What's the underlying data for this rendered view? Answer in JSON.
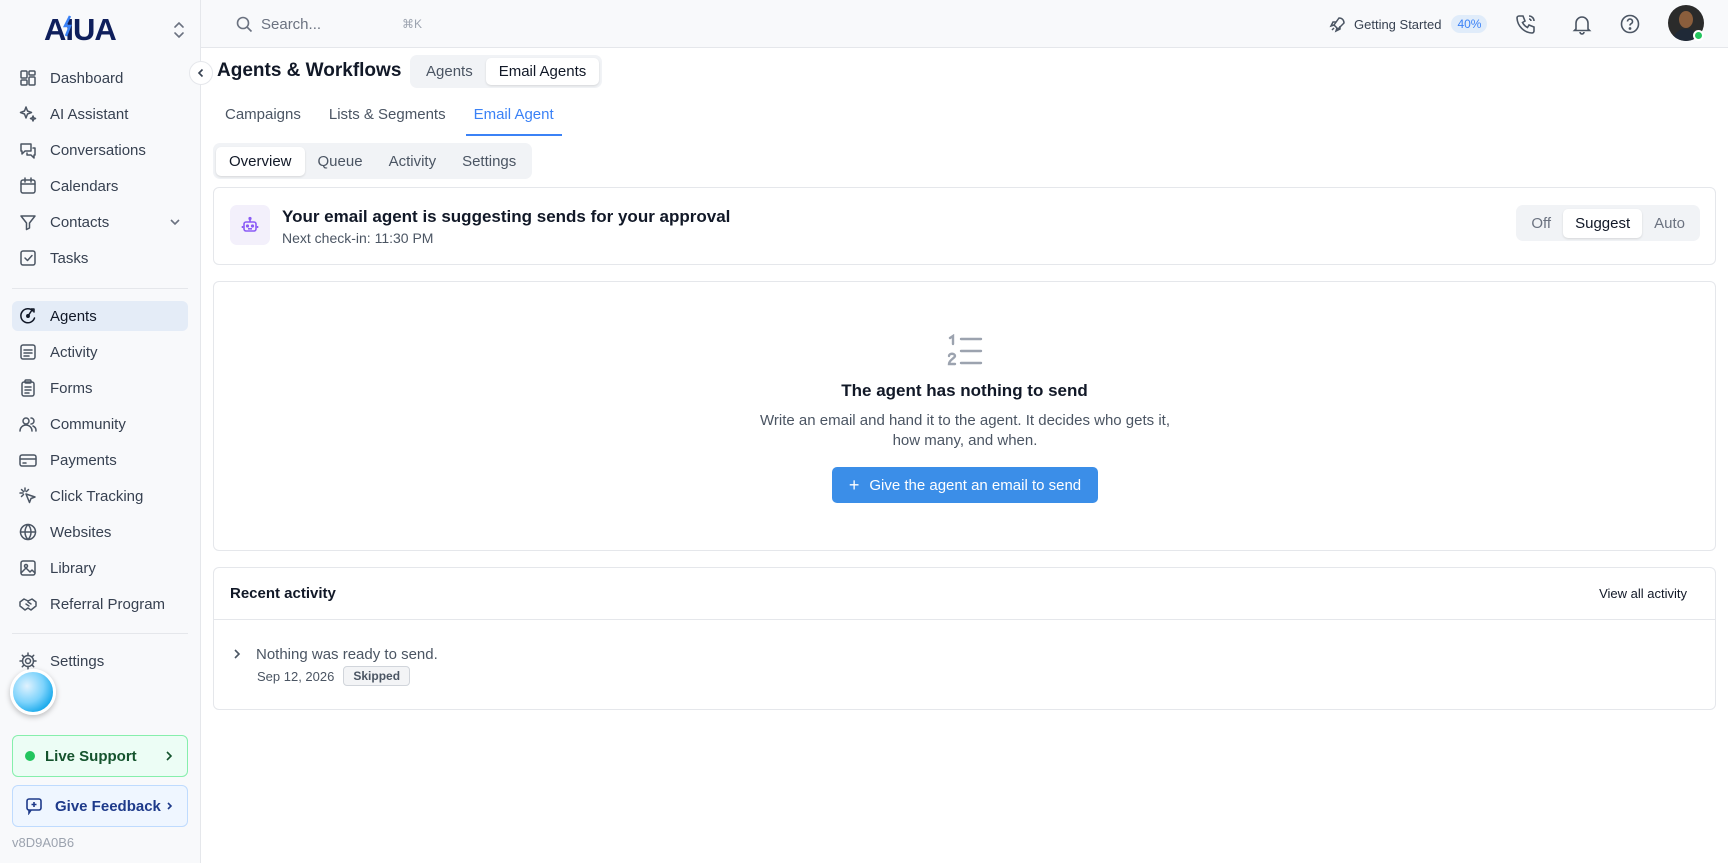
{
  "brand": {
    "logo_text": "AIUA"
  },
  "search": {
    "placeholder": "Search...",
    "shortcut": "⌘K"
  },
  "topbar": {
    "getting_started": "Getting Started",
    "progress_label": "40%",
    "progress": 0.4
  },
  "sidebar": {
    "items": [
      {
        "label": "Dashboard",
        "icon": "dashboard-icon"
      },
      {
        "label": "AI Assistant",
        "icon": "sparkles-icon"
      },
      {
        "label": "Conversations",
        "icon": "chat-icon"
      },
      {
        "label": "Calendars",
        "icon": "calendar-icon"
      },
      {
        "label": "Contacts",
        "icon": "filter-icon"
      },
      {
        "label": "Tasks",
        "icon": "checkbox-icon"
      },
      {
        "label": "Agents",
        "icon": "agent-icon",
        "active": true
      },
      {
        "label": "Activity",
        "icon": "activity-icon"
      },
      {
        "label": "Forms",
        "icon": "clipboard-icon"
      },
      {
        "label": "Community",
        "icon": "users-icon"
      },
      {
        "label": "Payments",
        "icon": "credit-card-icon"
      },
      {
        "label": "Click Tracking",
        "icon": "cursor-click-icon"
      },
      {
        "label": "Websites",
        "icon": "globe-icon"
      },
      {
        "label": "Library",
        "icon": "image-icon"
      },
      {
        "label": "Referral Program",
        "icon": "handshake-icon"
      },
      {
        "label": "Settings",
        "icon": "gear-icon"
      }
    ],
    "live_support": "Live Support",
    "give_feedback": "Give Feedback",
    "version": "v8D9A0B6"
  },
  "page": {
    "title": "Agents & Workflows",
    "segments": [
      "Agents",
      "Email Agents"
    ],
    "selected_segment": "Email Agents",
    "tabs": [
      "Campaigns",
      "Lists & Segments",
      "Email Agent"
    ],
    "selected_tab": "Email Agent",
    "subtabs": [
      "Overview",
      "Queue",
      "Activity",
      "Settings"
    ],
    "selected_subtab": "Overview"
  },
  "status": {
    "title": "Your email agent is suggesting sends for your approval",
    "next_checkin": "Next check-in: 11:30 PM",
    "modes": [
      "Off",
      "Suggest",
      "Auto"
    ],
    "selected_mode": "Suggest"
  },
  "empty": {
    "title": "The agent has nothing to send",
    "description": "Write an email and hand it to the agent. It decides who gets it, how many, and when.",
    "cta": "Give the agent an email to send"
  },
  "activity": {
    "title": "Recent activity",
    "view_all": "View all activity",
    "items": [
      {
        "text": "Nothing was ready to send.",
        "date": "Sep 12, 2026",
        "badge": "Skipped"
      }
    ]
  },
  "colors": {
    "accent": "#3b82f6",
    "button": "#3b8ee8",
    "online": "#22c55e",
    "sidebar_active": "#e4ecf7"
  }
}
